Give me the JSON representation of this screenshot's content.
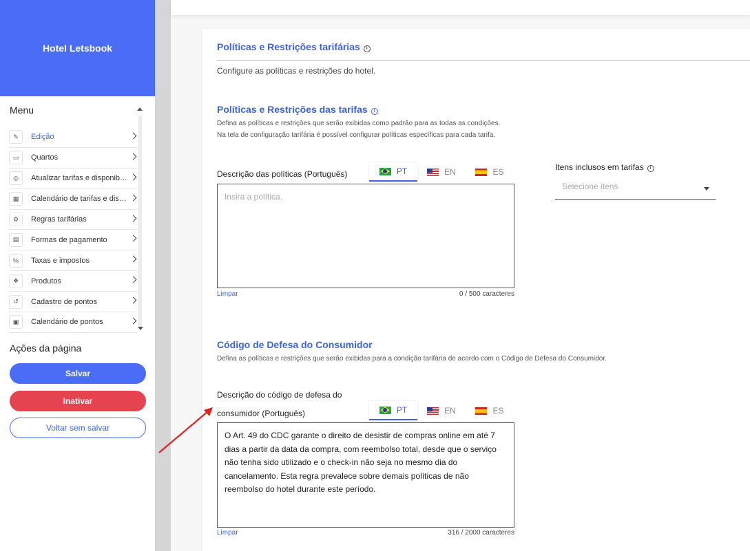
{
  "brand": {
    "name": "Hotel Letsbook",
    "color": "#4a6cf7"
  },
  "sidebar": {
    "menu_title": "Menu",
    "items": [
      {
        "label": "Edição",
        "icon": "pencil-icon",
        "glyph": "✎"
      },
      {
        "label": "Quartos",
        "icon": "bed-icon",
        "glyph": "▭"
      },
      {
        "label": "Atualizar tarifas e disponibilidade",
        "icon": "target-icon",
        "glyph": "◎"
      },
      {
        "label": "Calendário de tarifas e disponibilidade",
        "icon": "grid-calendar-icon",
        "glyph": "▦"
      },
      {
        "label": "Regras tarifárias",
        "icon": "gears-icon",
        "glyph": "⚙"
      },
      {
        "label": "Formas de pagamento",
        "icon": "payment-icon",
        "glyph": "▤"
      },
      {
        "label": "Taxas e impostos",
        "icon": "percent-icon",
        "glyph": "%"
      },
      {
        "label": "Produtos",
        "icon": "products-icon",
        "glyph": "❖"
      },
      {
        "label": "Cadastro de pontos",
        "icon": "history-icon",
        "glyph": "↺"
      },
      {
        "label": "Calendário de pontos",
        "icon": "calendar-icon",
        "glyph": "▣"
      }
    ],
    "actions_title": "Ações da página",
    "save_label": "Salvar",
    "inactivate_label": "Inativar",
    "back_label": "Voltar sem salvar"
  },
  "main": {
    "section_title": "Políticas e Restrições tarifárias",
    "section_sub": "Configure as políticas e restrições do hotel.",
    "tarifas": {
      "title": "Políticas e Restrições das tarifas",
      "desc_line1": "Defina as políticas e restrições que serão exibidas como padrão para as todas as condições.",
      "desc_line2": "Na tela de configuração tarifária é possível configurar políticas específicas para cada tarifa.",
      "field_label": "Descrição das políticas (Português)",
      "placeholder": "Insira a política.",
      "clear_label": "Limpar",
      "counter": "0 / 500 caracteres"
    },
    "languages": [
      "PT",
      "EN",
      "ES"
    ],
    "itens": {
      "label": "Itens inclusos em tarifas",
      "placeholder": "Selecione itens"
    },
    "cdc": {
      "title": "Código de Defesa do Consumidor",
      "desc": "Defina as políticas e restrições que serão exibidas para a condição tarifária de acordo com o Código de Defesa do Consumidor.",
      "field_label_line1": "Descrição do código de defesa do",
      "field_label_line2": "consumidor (Português)",
      "text": "O Art. 49 do CDC garante o direito de desistir de compras online em até 7 dias a partir da data da compra, com reembolso total, desde que o serviço não tenha sido utilizado e o check-in não seja no mesmo dia do cancelamento. Esta regra prevalece sobre demais políticas de não reembolso do hotel durante este período.",
      "clear_label": "Limpar",
      "counter": "316 / 2000 caracteres"
    }
  },
  "colors": {
    "accent": "#3f63e0",
    "danger": "#e5434f",
    "annotation_arrow": "#e0201c"
  }
}
